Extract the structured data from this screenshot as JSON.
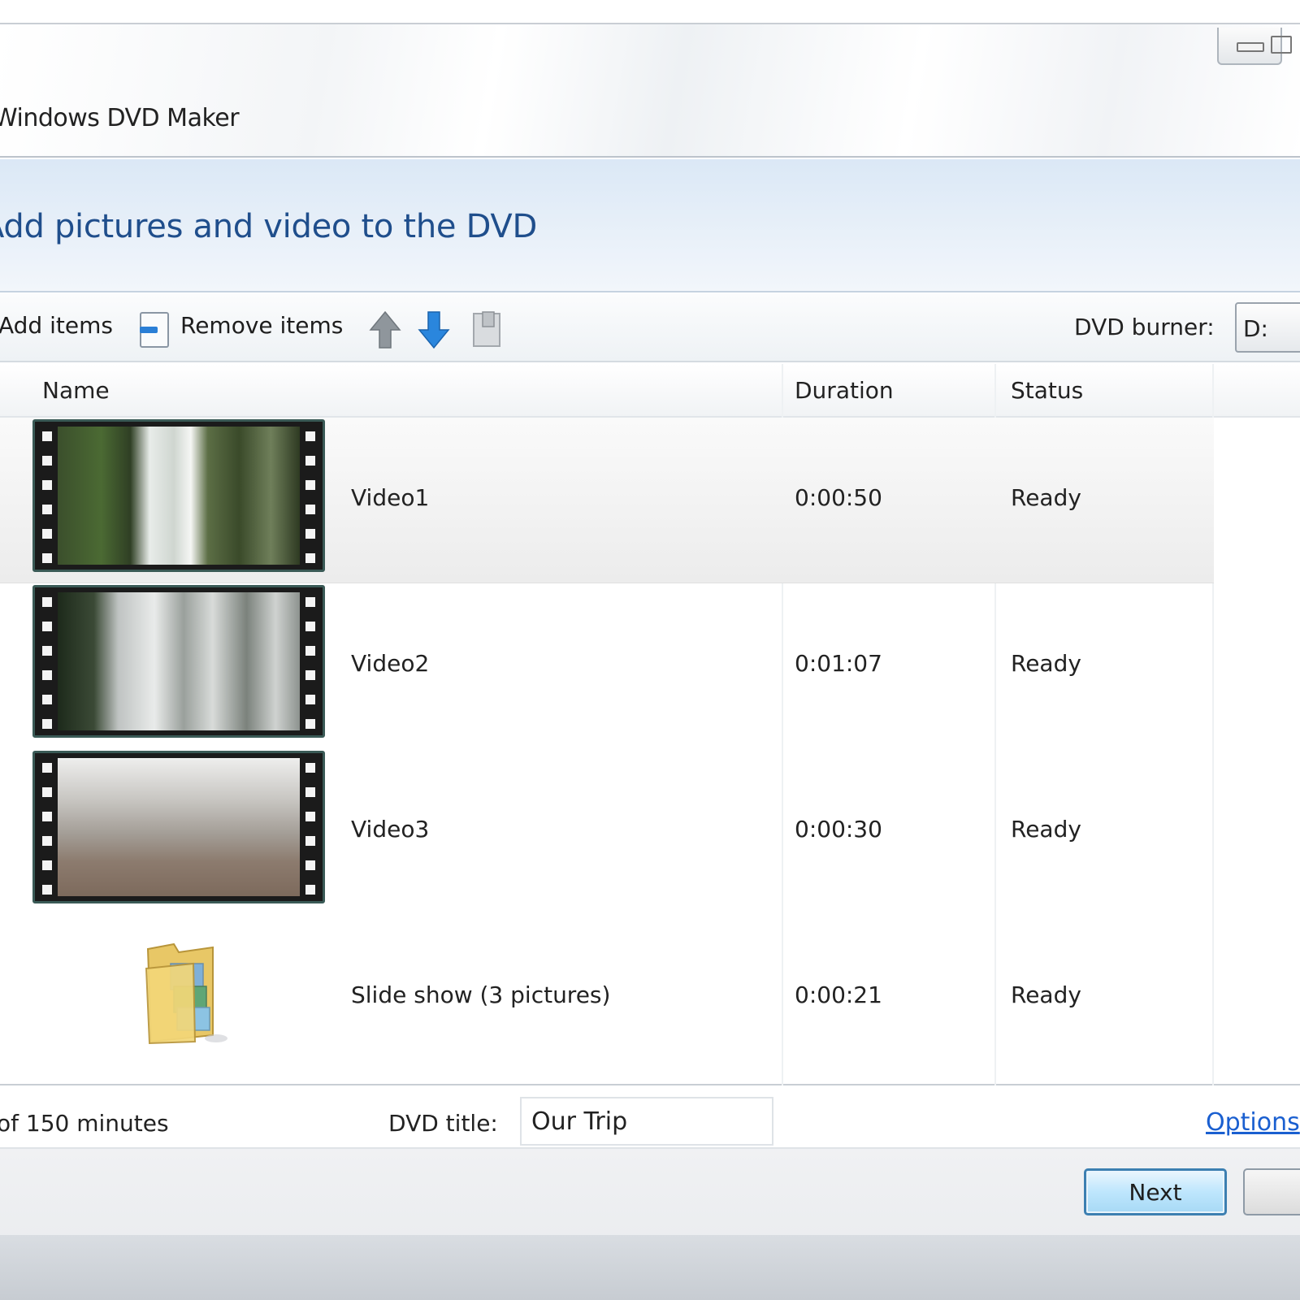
{
  "window": {
    "title": "Windows DVD Maker"
  },
  "header": {
    "heading": "Add pictures and video to the DVD"
  },
  "toolbar": {
    "add_items": "Add items",
    "remove_items": "Remove items",
    "burner_label": "DVD burner:",
    "burner_value": "D:"
  },
  "list": {
    "columns": {
      "name": "Name",
      "duration": "Duration",
      "status": "Status"
    },
    "rows": [
      {
        "name": "Video1",
        "duration": "0:00:50",
        "status": "Ready",
        "thumb": "video"
      },
      {
        "name": "Video2",
        "duration": "0:01:07",
        "status": "Ready",
        "thumb": "video"
      },
      {
        "name": "Video3",
        "duration": "0:00:30",
        "status": "Ready",
        "thumb": "video"
      },
      {
        "name": "Slide show (3 pictures)",
        "duration": "0:00:21",
        "status": "Ready",
        "thumb": "folder"
      }
    ]
  },
  "footer": {
    "capacity": "of 150 minutes",
    "dvd_title_label": "DVD title:",
    "dvd_title_value": "Our Trip",
    "options_link": "Options",
    "next_label": "Next"
  },
  "icons": {
    "remove": "remove-items-icon",
    "move_up": "arrow-up-icon",
    "move_down": "arrow-down-icon",
    "document": "document-icon",
    "folder": "folder-icon"
  },
  "colors": {
    "heading": "#1f4e8c",
    "link": "#1a5fd0",
    "next_button_border": "#3c7fb1"
  }
}
